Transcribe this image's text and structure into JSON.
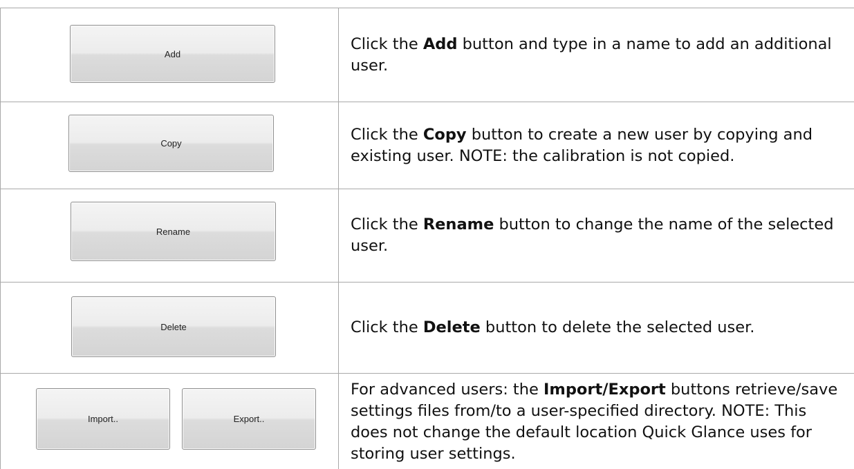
{
  "rows": [
    {
      "button_label": "Add",
      "text_before": "Click the ",
      "bold": "Add",
      "text_after": " button and type in a name to add an additional user."
    },
    {
      "button_label": "Copy",
      "text_before": "Click the ",
      "bold": "Copy",
      "text_after": " button to create a new user by copying and existing user.  NOTE:  the calibration is not copied."
    },
    {
      "button_label": "Rename",
      "text_before": "Click the ",
      "bold": "Rename",
      "text_after": " button to change the name of the selected user."
    },
    {
      "button_label": "Delete",
      "text_before": "Click the ",
      "bold": "Delete",
      "text_after": " button to delete the selected user."
    },
    {
      "button_labels": [
        "Import..",
        "Export.."
      ],
      "text_before": "For advanced users: the ",
      "bold": "Import/Export",
      "text_after": " buttons retrieve/save settings files from/to a user-specified directory.  NOTE:  This does not change the default location Quick Glance uses for storing user settings."
    }
  ]
}
